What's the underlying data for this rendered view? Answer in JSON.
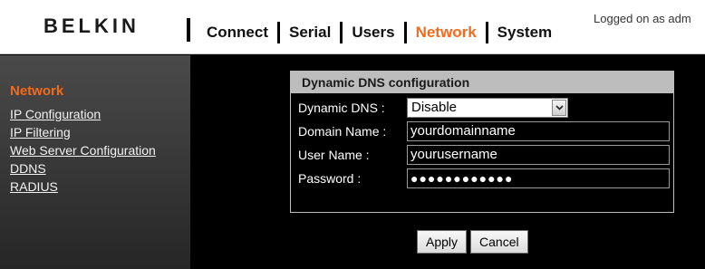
{
  "header": {
    "logo": "BELKIN",
    "nav": [
      {
        "label": "Connect",
        "active": false
      },
      {
        "label": "Serial",
        "active": false
      },
      {
        "label": "Users",
        "active": false
      },
      {
        "label": "Network",
        "active": true
      },
      {
        "label": "System",
        "active": false
      }
    ],
    "logged_on": "Logged on as adm"
  },
  "sidebar": {
    "title": "Network",
    "items": [
      {
        "label": "IP Configuration"
      },
      {
        "label": "IP Filtering"
      },
      {
        "label": "Web Server Configuration"
      },
      {
        "label": "DDNS"
      },
      {
        "label": "RADIUS"
      }
    ]
  },
  "panel": {
    "title": "Dynamic DNS configuration",
    "dynamic_dns": {
      "label": "Dynamic DNS :",
      "value": "Disable",
      "icon": "chevron-down-icon"
    },
    "domain_name": {
      "label": "Domain Name :",
      "value": "yourdomainname"
    },
    "user_name": {
      "label": "User Name :",
      "value": "yourusername"
    },
    "password": {
      "label": "Password :",
      "value": "●●●●●●●●●●●●"
    }
  },
  "actions": {
    "apply": "Apply",
    "cancel": "Cancel"
  },
  "colors": {
    "accent": "#f26b1d",
    "panel_header": "#bdbdbd"
  }
}
